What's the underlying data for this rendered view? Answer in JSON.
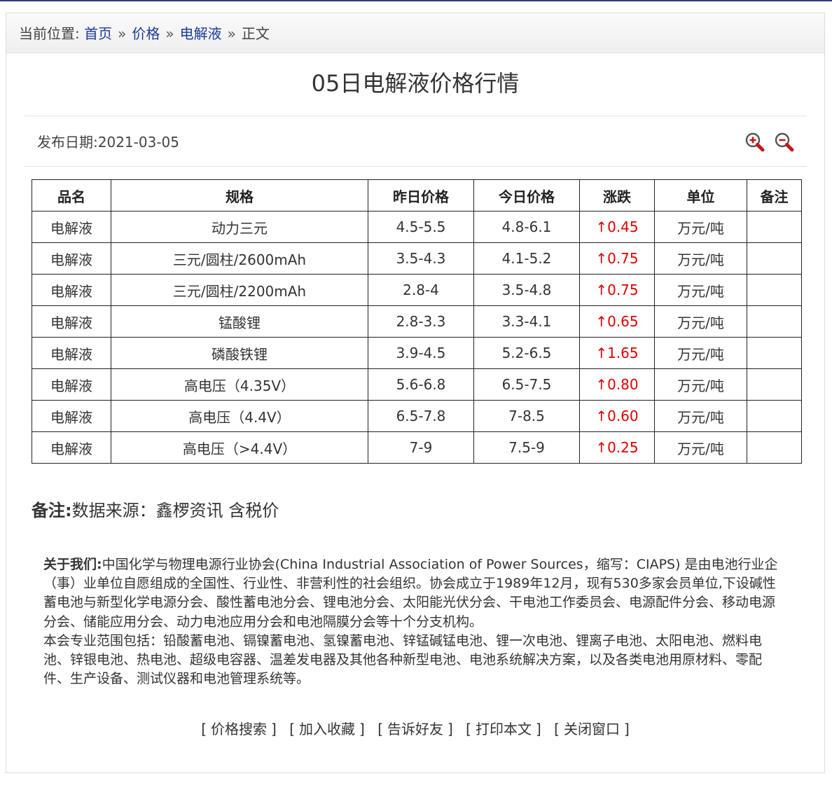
{
  "breadcrumb": {
    "prefix": "当前位置:",
    "separator": "»",
    "items": [
      "首页",
      "价格",
      "电解液",
      "正文"
    ]
  },
  "article": {
    "title": "05日电解液价格行情",
    "date_label": "发布日期:",
    "date_value": "2021-03-05"
  },
  "icons": {
    "zoom_in": "zoom-in-icon",
    "zoom_out": "zoom-out-icon"
  },
  "colors": {
    "increase": "#e00000",
    "link": "#1a3c96",
    "table_border": "#222222"
  },
  "table": {
    "headers": [
      "品名",
      "规格",
      "昨日价格",
      "今日价格",
      "涨跌",
      "单位",
      "备注"
    ],
    "rows": [
      {
        "name": "电解液",
        "spec": "动力三元",
        "yesterday": "4.5-5.5",
        "today": "4.8-6.1",
        "change": "↑0.45",
        "unit": "万元/吨",
        "remark": ""
      },
      {
        "name": "电解液",
        "spec": "三元/圆柱/2600mAh",
        "yesterday": "3.5-4.3",
        "today": "4.1-5.2",
        "change": "↑0.75",
        "unit": "万元/吨",
        "remark": ""
      },
      {
        "name": "电解液",
        "spec": "三元/圆柱/2200mAh",
        "yesterday": "2.8-4",
        "today": "3.5-4.8",
        "change": "↑0.75",
        "unit": "万元/吨",
        "remark": ""
      },
      {
        "name": "电解液",
        "spec": "锰酸锂",
        "yesterday": "2.8-3.3",
        "today": "3.3-4.1",
        "change": "↑0.65",
        "unit": "万元/吨",
        "remark": ""
      },
      {
        "name": "电解液",
        "spec": "磷酸铁锂",
        "yesterday": "3.9-4.5",
        "today": "5.2-6.5",
        "change": "↑1.65",
        "unit": "万元/吨",
        "remark": ""
      },
      {
        "name": "电解液",
        "spec": "高电压（4.35V）",
        "yesterday": "5.6-6.8",
        "today": "6.5-7.5",
        "change": "↑0.80",
        "unit": "万元/吨",
        "remark": ""
      },
      {
        "name": "电解液",
        "spec": "高电压（4.4V）",
        "yesterday": "6.5-7.8",
        "today": "7-8.5",
        "change": "↑0.60",
        "unit": "万元/吨",
        "remark": ""
      },
      {
        "name": "电解液",
        "spec": "高电压（>4.4V）",
        "yesterday": "7-9",
        "today": "7.5-9",
        "change": "↑0.25",
        "unit": "万元/吨",
        "remark": ""
      }
    ]
  },
  "note": {
    "label": "备注:",
    "text": "数据来源：鑫椤资讯 含税价"
  },
  "about": {
    "label": "关于我们:",
    "text": "中国化学与物理电源行业协会(China Industrial Association of Power Sources，缩写：CIAPS) 是由电池行业企（事）业单位自愿组成的全国性、行业性、非营利性的社会组织。协会成立于1989年12月，现有530多家会员单位,下设碱性蓄电池与新型化学电源分会、酸性蓄电池分会、锂电池分会、太阳能光伏分会、干电池工作委员会、电源配件分会、移动电源分会、储能应用分会、动力电池应用分会和电池隔膜分会等十个分支机构。",
    "text2": "本会专业范围包括：铅酸蓄电池、镉镍蓄电池、氢镍蓄电池、锌锰碱锰电池、锂一次电池、锂离子电池、太阳电池、燃料电池、锌银电池、热电池、超级电容器、温差发电器及其他各种新型电池、电池系统解决方案，以及各类电池用原材料、零配件、生产设备、测试仪器和电池管理系统等。"
  },
  "actions": [
    "价格搜索",
    "加入收藏",
    "告诉好友",
    "打印本文",
    "关闭窗口"
  ]
}
